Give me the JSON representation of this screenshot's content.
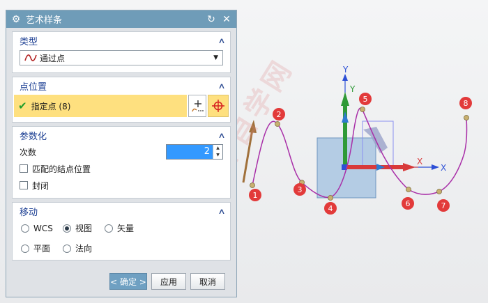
{
  "dialog": {
    "title": "艺术样条",
    "groups": {
      "type": {
        "header": "类型",
        "selected": "通过点"
      },
      "point_position": {
        "header": "点位置",
        "specify": "指定点 (8)"
      },
      "parameterization": {
        "header": "参数化",
        "degree_label": "次数",
        "degree_value": "2",
        "matched_knots": "匹配的结点位置",
        "closed": "封闭"
      },
      "move": {
        "header": "移动",
        "options": [
          "WCS",
          "视图",
          "矢量",
          "平面",
          "法向"
        ],
        "selected": "视图"
      }
    },
    "buttons": {
      "ok": "< 确定 >",
      "apply": "应用",
      "cancel": "取消"
    }
  },
  "viewport": {
    "axis_labels": [
      "Y",
      "Y",
      "X",
      "X"
    ],
    "point_labels": [
      "1",
      "2",
      "3",
      "4",
      "5",
      "6",
      "7",
      "8"
    ],
    "colors": {
      "spline": "#a92fa8",
      "point_marker": "#e23a3a",
      "wcs_y": "#2f9a37",
      "wcs_x": "#d83a3a",
      "abs_axis": "#2c4fd6",
      "plane": "#8fb3d6"
    }
  },
  "watermark": "软件自学网"
}
